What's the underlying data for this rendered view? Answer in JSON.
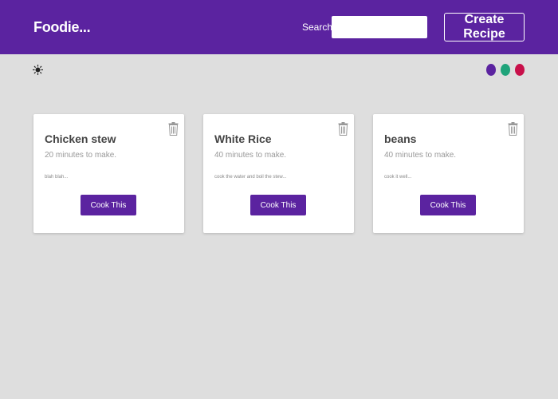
{
  "navbar": {
    "brand": "Foodie...",
    "search_label": "Search:",
    "search_value": "",
    "search_placeholder": "",
    "create_button": "Create Recipe",
    "color": "#5b23a0"
  },
  "theme_toggle": {
    "icon": "sun-icon"
  },
  "color_swatches": [
    {
      "name": "purple",
      "color": "#5b23a0"
    },
    {
      "name": "green",
      "color": "#1fa37a"
    },
    {
      "name": "red",
      "color": "#c8104a"
    }
  ],
  "recipes": [
    {
      "title": "Chicken stew",
      "time": "20 minutes to make.",
      "method": "blah blah...",
      "button": "Cook This"
    },
    {
      "title": "White Rice",
      "time": "40 minutes to make.",
      "method": "cook the water and boil the stew...",
      "button": "Cook This"
    },
    {
      "title": "beans",
      "time": "40 minutes to make.",
      "method": "cook it well...",
      "button": "Cook This"
    }
  ]
}
